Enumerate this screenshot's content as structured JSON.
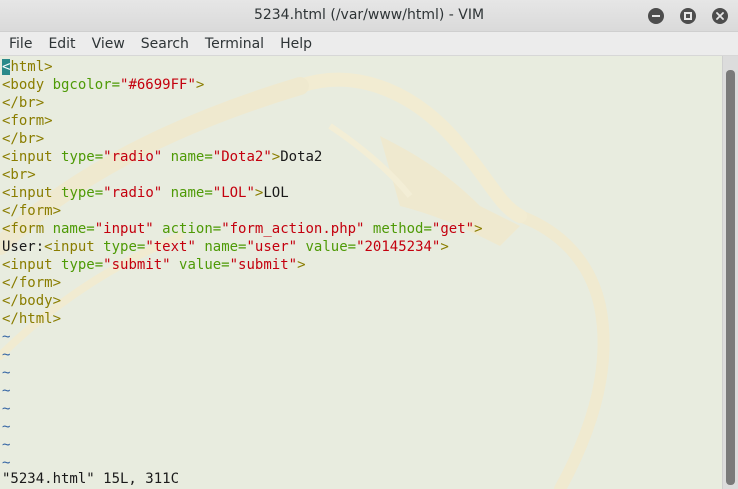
{
  "window": {
    "title": "5234.html (/var/www/html) - VIM"
  },
  "menu": [
    "File",
    "Edit",
    "View",
    "Search",
    "Terminal",
    "Help"
  ],
  "editor": {
    "lines": [
      [
        {
          "t": "tag",
          "v": "<"
        },
        {
          "t": "tag",
          "v": "html>"
        }
      ],
      [
        {
          "t": "tag",
          "v": "<body "
        },
        {
          "t": "attr",
          "v": "bgcolor="
        },
        {
          "t": "str",
          "v": "\"#6699FF\""
        },
        {
          "t": "tag",
          "v": ">"
        }
      ],
      [
        {
          "t": "tag",
          "v": "</br>"
        }
      ],
      [
        {
          "t": "tag",
          "v": "<form>"
        }
      ],
      [
        {
          "t": "tag",
          "v": "</br>"
        }
      ],
      [
        {
          "t": "tag",
          "v": "<input "
        },
        {
          "t": "attr",
          "v": "type="
        },
        {
          "t": "str",
          "v": "\"radio\""
        },
        {
          "t": "attr",
          "v": " name="
        },
        {
          "t": "str",
          "v": "\"Dota2\""
        },
        {
          "t": "tag",
          "v": ">"
        },
        {
          "t": "txt",
          "v": "Dota2"
        }
      ],
      [
        {
          "t": "tag",
          "v": "<br>"
        }
      ],
      [
        {
          "t": "tag",
          "v": "<input "
        },
        {
          "t": "attr",
          "v": "type="
        },
        {
          "t": "str",
          "v": "\"radio\""
        },
        {
          "t": "attr",
          "v": " name="
        },
        {
          "t": "str",
          "v": "\"LOL\""
        },
        {
          "t": "tag",
          "v": ">"
        },
        {
          "t": "txt",
          "v": "LOL"
        }
      ],
      [
        {
          "t": "tag",
          "v": "</form>"
        }
      ],
      [
        {
          "t": "tag",
          "v": "<form "
        },
        {
          "t": "attr",
          "v": "name="
        },
        {
          "t": "str",
          "v": "\"input\""
        },
        {
          "t": "attr",
          "v": " action="
        },
        {
          "t": "str",
          "v": "\"form_action.php\""
        },
        {
          "t": "attr",
          "v": " method="
        },
        {
          "t": "str",
          "v": "\"get\""
        },
        {
          "t": "tag",
          "v": ">"
        }
      ],
      [
        {
          "t": "txt",
          "v": "User:"
        },
        {
          "t": "tag",
          "v": "<input "
        },
        {
          "t": "attr",
          "v": "type="
        },
        {
          "t": "str",
          "v": "\"text\""
        },
        {
          "t": "attr",
          "v": " name="
        },
        {
          "t": "str",
          "v": "\"user\""
        },
        {
          "t": "attr",
          "v": " value="
        },
        {
          "t": "str",
          "v": "\"20145234\""
        },
        {
          "t": "tag",
          "v": ">"
        }
      ],
      [
        {
          "t": "tag",
          "v": "<input "
        },
        {
          "t": "attr",
          "v": "type="
        },
        {
          "t": "str",
          "v": "\"submit\""
        },
        {
          "t": "attr",
          "v": " value="
        },
        {
          "t": "str",
          "v": "\"submit\""
        },
        {
          "t": "tag",
          "v": ">"
        }
      ],
      [
        {
          "t": "tag",
          "v": "</form>"
        }
      ],
      [
        {
          "t": "tag",
          "v": "</body>"
        }
      ],
      [
        {
          "t": "tag",
          "v": "</html>"
        }
      ]
    ],
    "empty_line_marker": "~",
    "empty_line_count": 8,
    "status_line": "\"5234.html\" 15L, 311C"
  },
  "colors": {
    "tag": "#8a7d00",
    "attr": "#4e9a06",
    "string": "#c4000e",
    "tilde": "#3465a4",
    "cursor": "#2a8a8a"
  },
  "icons": {
    "minimize": "minimize-icon",
    "maximize": "maximize-icon",
    "close": "close-icon"
  }
}
